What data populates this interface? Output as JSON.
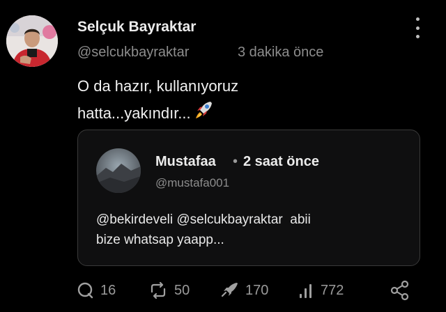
{
  "post": {
    "author_name": "Selçuk Bayraktar",
    "author_handle": "@selcukbayraktar",
    "time": "3 dakika önce",
    "text_line1": "O da hazır, kullanıyoruz",
    "text_line2": "hatta...yakındır...",
    "emoji": "rocket-icon",
    "menu_icon": "more-vertical-icon"
  },
  "quote": {
    "author_name": "Mustafaa",
    "separator": "•",
    "time": "2 saat önce",
    "author_handle": "@mustafa001",
    "text_line1": "@bekirdeveli @selcukbayraktar  abii",
    "text_line2": "bize whatsap yaapp..."
  },
  "actions": {
    "reply_count": "16",
    "repost_count": "50",
    "boost_count": "170",
    "views_count": "772",
    "icons": [
      "reply-icon",
      "repost-icon",
      "boost-icon",
      "views-icon",
      "share-icon"
    ]
  },
  "colors": {
    "background": "#000000",
    "text": "#e7e9ea",
    "muted": "#8d8d8d",
    "card_border": "#3a3a3a"
  }
}
